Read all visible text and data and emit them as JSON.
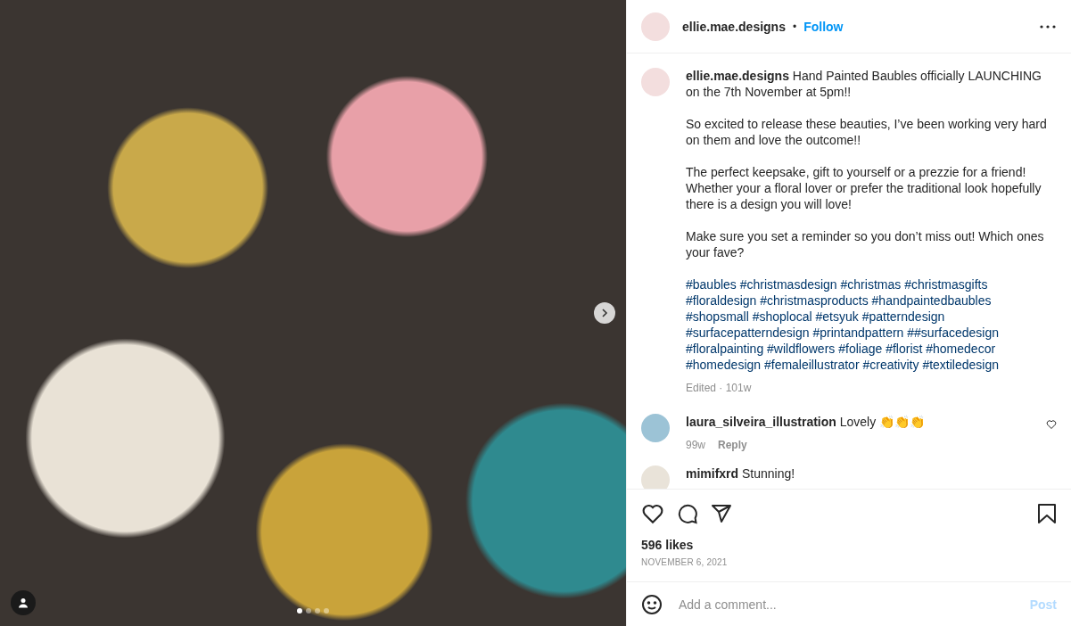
{
  "photo": {
    "carousel_dots": [
      {
        "selected": true
      },
      {
        "selected": false
      },
      {
        "selected": false
      },
      {
        "selected": false
      }
    ]
  },
  "header": {
    "username": "ellie.mae.designs",
    "separator": "•",
    "follow": "Follow"
  },
  "caption": {
    "paragraphs": [
      "**ellie.mae.designs** Hand Painted Baubles officially LAUNCHING on the 7th November at 5pm!!",
      "So excited to release these beauties, I’ve been working very hard on them and love the outcome!!",
      "The perfect keepsake, gift to yourself or a prezzie for a friend! Whether your a floral lover or prefer the traditional look hopefully there is a design you will love!",
      "Make sure you set a reminder so you don’t miss out! Which ones your fave?"
    ],
    "hashtags": [
      "#baubles",
      "#christmasdesign",
      "#christmas",
      "#christmasgifts",
      "#floraldesign",
      "#christmasproducts",
      "#handpaintedbaubles",
      "#shopsmall",
      "#shoplocal",
      "#etsyuk",
      "#patterndesign",
      "#surfacepatterndesign",
      "#printandpattern",
      "##surfacedesign",
      "#floralpainting",
      "#wildflowers",
      "#foliage",
      "#florist",
      "#homedecor",
      "#homedesign",
      "#femaleillustrator",
      "#creativity",
      "#textiledesign"
    ],
    "meta": "Edited · 101w"
  },
  "comments": [
    {
      "username": "laura_silveira_illustration",
      "text": "Lovely 👏👏👏",
      "time": "99w",
      "reply": "Reply",
      "liked": false
    },
    {
      "username": "mimifxrd",
      "text": "Stunning!"
    }
  ],
  "actions": {
    "liked": false,
    "saved": false
  },
  "likes": "596 likes",
  "date": "NOVEMBER 6, 2021",
  "comment_box": {
    "placeholder": "Add a comment...",
    "post": "Post"
  }
}
